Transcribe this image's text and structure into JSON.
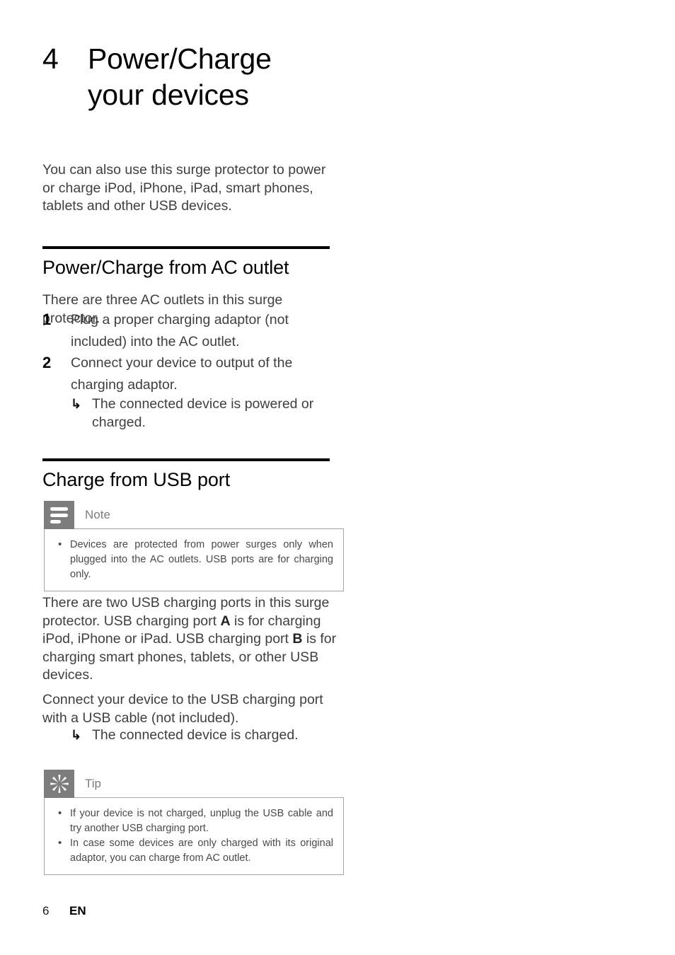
{
  "chapter": {
    "number": "4",
    "title_line1": "Power/Charge",
    "title_line2": "your devices"
  },
  "intro": {
    "text": "You can also use this surge protector to power or charge iPod, iPhone, iPad, smart phones, tablets and other USB devices."
  },
  "section_ac": {
    "heading": "Power/Charge from AC outlet",
    "lead": "There are three AC outlets in this surge protector.",
    "steps": [
      {
        "number": "1",
        "text": "Plug a proper charging adaptor (not included) into the AC outlet."
      },
      {
        "number": "2",
        "text": "Connect your device to output of the charging adaptor."
      }
    ],
    "result_arrow": "↳",
    "result": "The connected device is powered or charged."
  },
  "section_usb": {
    "heading": "Charge from USB port",
    "note": {
      "icon": "note-lines-icon",
      "label": "Note",
      "bullets": [
        "Devices are protected from power surges only when plugged into the AC outlets. USB ports are for charging only."
      ]
    },
    "para1_pre": "There are two USB charging ports in this surge protector. USB charging port ",
    "para1_boldA": "A",
    "para1_mid": " is for charging iPod, iPhone or iPad. USB charging port ",
    "para1_boldB": "B",
    "para1_post": " is for charging smart phones, tablets, or other USB devices.",
    "para2": "Connect your device to the USB charging port with a USB cable (not included).",
    "result_arrow": "↳",
    "result": "The connected device is charged.",
    "tip": {
      "icon": "asterisk-starburst-icon",
      "label": "Tip",
      "bullets": [
        "If your device is not charged, unplug the USB cable and try another USB charging port.",
        "In case some devices are only charged with its original adaptor, you can charge from AC outlet."
      ]
    }
  },
  "footer": {
    "page_number": "6",
    "language": "EN"
  },
  "colors": {
    "text": "#3f3f3f",
    "heading": "#000000",
    "callout_gray": "#7d7d7d",
    "callout_border": "#a6a6a6",
    "page_background": "#ffffff"
  }
}
